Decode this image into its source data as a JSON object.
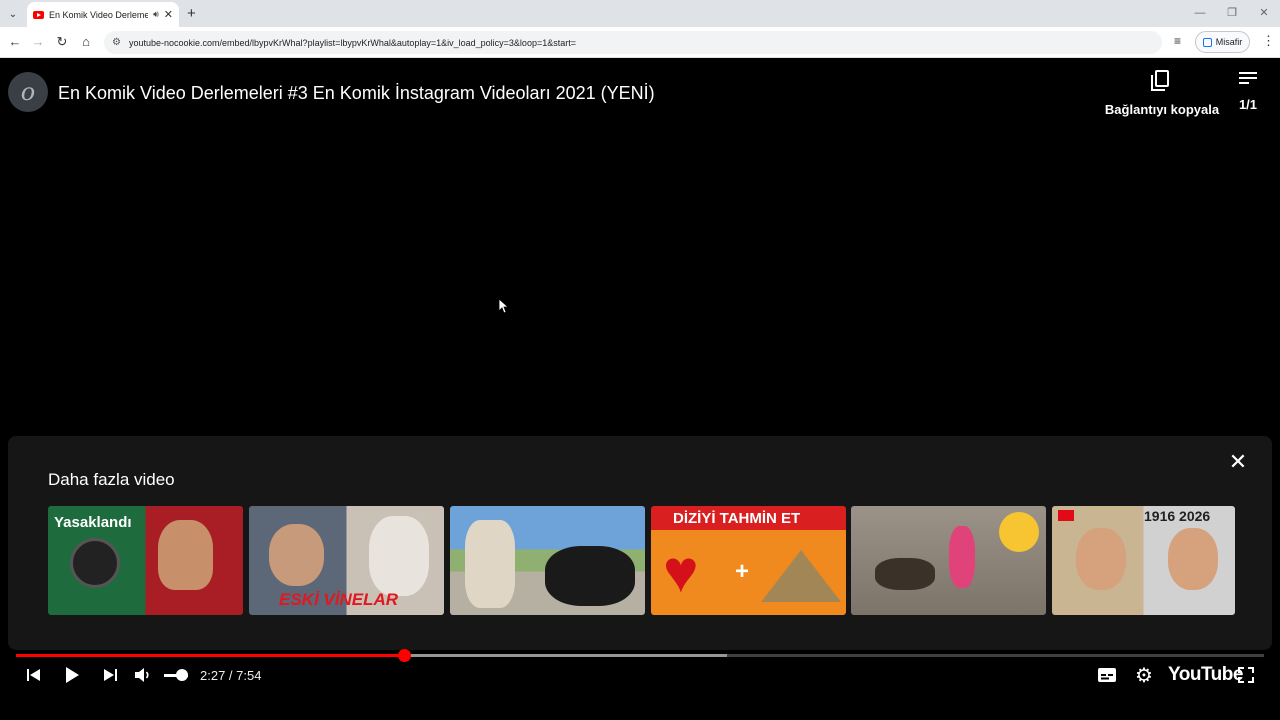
{
  "browser": {
    "tab_title": "En Komik Video Derlemeleri",
    "url": "youtube-nocookie.com/embed/lbypvKrWhal?playlist=lbypvKrWhal&autoplay=1&iv_load_policy=3&loop=1&start=",
    "profile_label": "Misafir"
  },
  "player": {
    "video_title": "En Komik Video Derlemeleri #3 En Komik İnstagram Videoları 2021 (YENİ)",
    "channel_avatar_text": "o",
    "copy_link_label": "Bağlantıyı kopyala",
    "playlist_position": "1/1",
    "more_videos_title": "Daha fazla video",
    "thumbnails": [
      {
        "label": "Yasaklandı",
        "colors": [
          "#1e6b3e",
          "#a81e24"
        ]
      },
      {
        "label": "ESKİ VİNELAR",
        "colors": [
          "#5c6878",
          "#c9c1b6"
        ]
      },
      {
        "label": "",
        "colors": [
          "#6ea3d9",
          "#b6b0a2"
        ]
      },
      {
        "label": "DİZİYİ TAHMİN ET",
        "colors": [
          "#d91f1f",
          "#f08a1e"
        ]
      },
      {
        "label": "",
        "colors": [
          "#9b9388",
          "#7c7468"
        ]
      },
      {
        "label": "1916 2026",
        "colors": [
          "#c9b592",
          "#d1d1d1"
        ]
      }
    ],
    "time_display": "2:27 / 7:54",
    "progress": {
      "played_fraction": 0.311,
      "loaded_fraction": 0.57
    },
    "volume_fraction": 0.5,
    "youtube_logo": "YouTube",
    "accent_color": "#ff0000"
  }
}
